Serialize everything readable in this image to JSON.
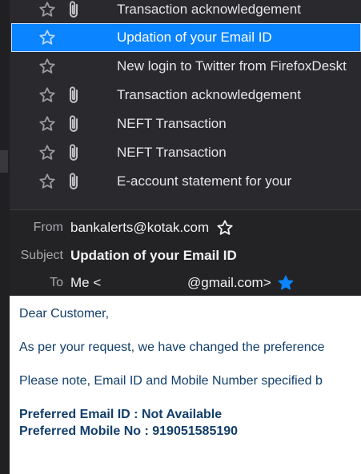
{
  "messages": [
    {
      "subject": "Transaction acknowledgement",
      "attachment": true,
      "selected": false
    },
    {
      "subject": "Updation of your Email ID",
      "attachment": false,
      "selected": true
    },
    {
      "subject": "New login to Twitter from FirefoxDeskt",
      "attachment": false,
      "selected": false
    },
    {
      "subject": "Transaction acknowledgement",
      "attachment": true,
      "selected": false
    },
    {
      "subject": "NEFT Transaction",
      "attachment": true,
      "selected": false
    },
    {
      "subject": "NEFT Transaction",
      "attachment": true,
      "selected": false
    },
    {
      "subject": "E-account statement for your",
      "attachment": true,
      "selected": false
    }
  ],
  "header": {
    "from_label": "From",
    "from_value": "bankalerts@kotak.com",
    "subject_label": "Subject",
    "subject_value": "Updation of your Email ID",
    "to_label": "To",
    "to_value_name": "Me <",
    "to_value_domain": "@gmail.com>"
  },
  "body": {
    "greeting": "Dear Customer,",
    "line1": "As per your request, we have changed the preference",
    "line2": "Please note, Email ID and Mobile Number specified b",
    "pref_email": "Preferred Email ID : Not Available",
    "pref_mobile": "Preferred Mobile No : 919051585190"
  },
  "colors": {
    "selection": "#0a84ff",
    "body_text": "#123e6b",
    "star_filled": "#0a84ff"
  },
  "icons": {
    "star": "star-icon",
    "attachment": "paperclip-icon"
  }
}
